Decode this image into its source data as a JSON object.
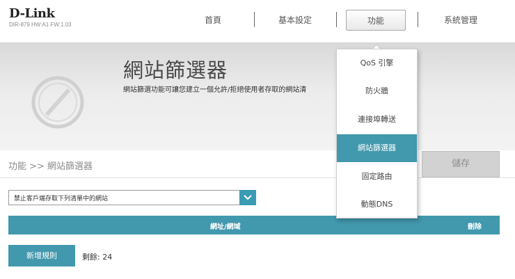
{
  "logo": {
    "brand": "D-Link",
    "model": "DIR-879 HW:A1 FW:1.03"
  },
  "nav": [
    {
      "label": "首頁"
    },
    {
      "label": "基本設定"
    },
    {
      "label": "功能",
      "active": true
    },
    {
      "label": "系統管理"
    }
  ],
  "banner": {
    "title": "網站篩選器",
    "description": "網站篩選功能可讓您建立一個允許/拒絕使用者存取的網站清",
    "icon": "website-filter-icon"
  },
  "breadcrumb": "功能 >> 網站篩選器",
  "save_label": "儲存",
  "policy": {
    "selected": "禁止客戶端存取下列清單中的網站",
    "icon": "chevron-down-icon"
  },
  "table": {
    "col_website": "網址/網域",
    "col_delete": "刪除"
  },
  "add_rule_label": "新增規則",
  "remaining_label": "剩餘: 24",
  "dropdown": {
    "items": [
      {
        "label": "QoS 引擎"
      },
      {
        "label": "防火牆"
      },
      {
        "label": "連接埠轉送"
      },
      {
        "label": "網站篩選器",
        "active": true
      },
      {
        "label": "固定路由"
      },
      {
        "label": "動態DNS"
      }
    ]
  },
  "colors": {
    "accent": "#4298ad",
    "select_button": "#3a9bb4",
    "save_disabled": "#d2d2d2"
  }
}
